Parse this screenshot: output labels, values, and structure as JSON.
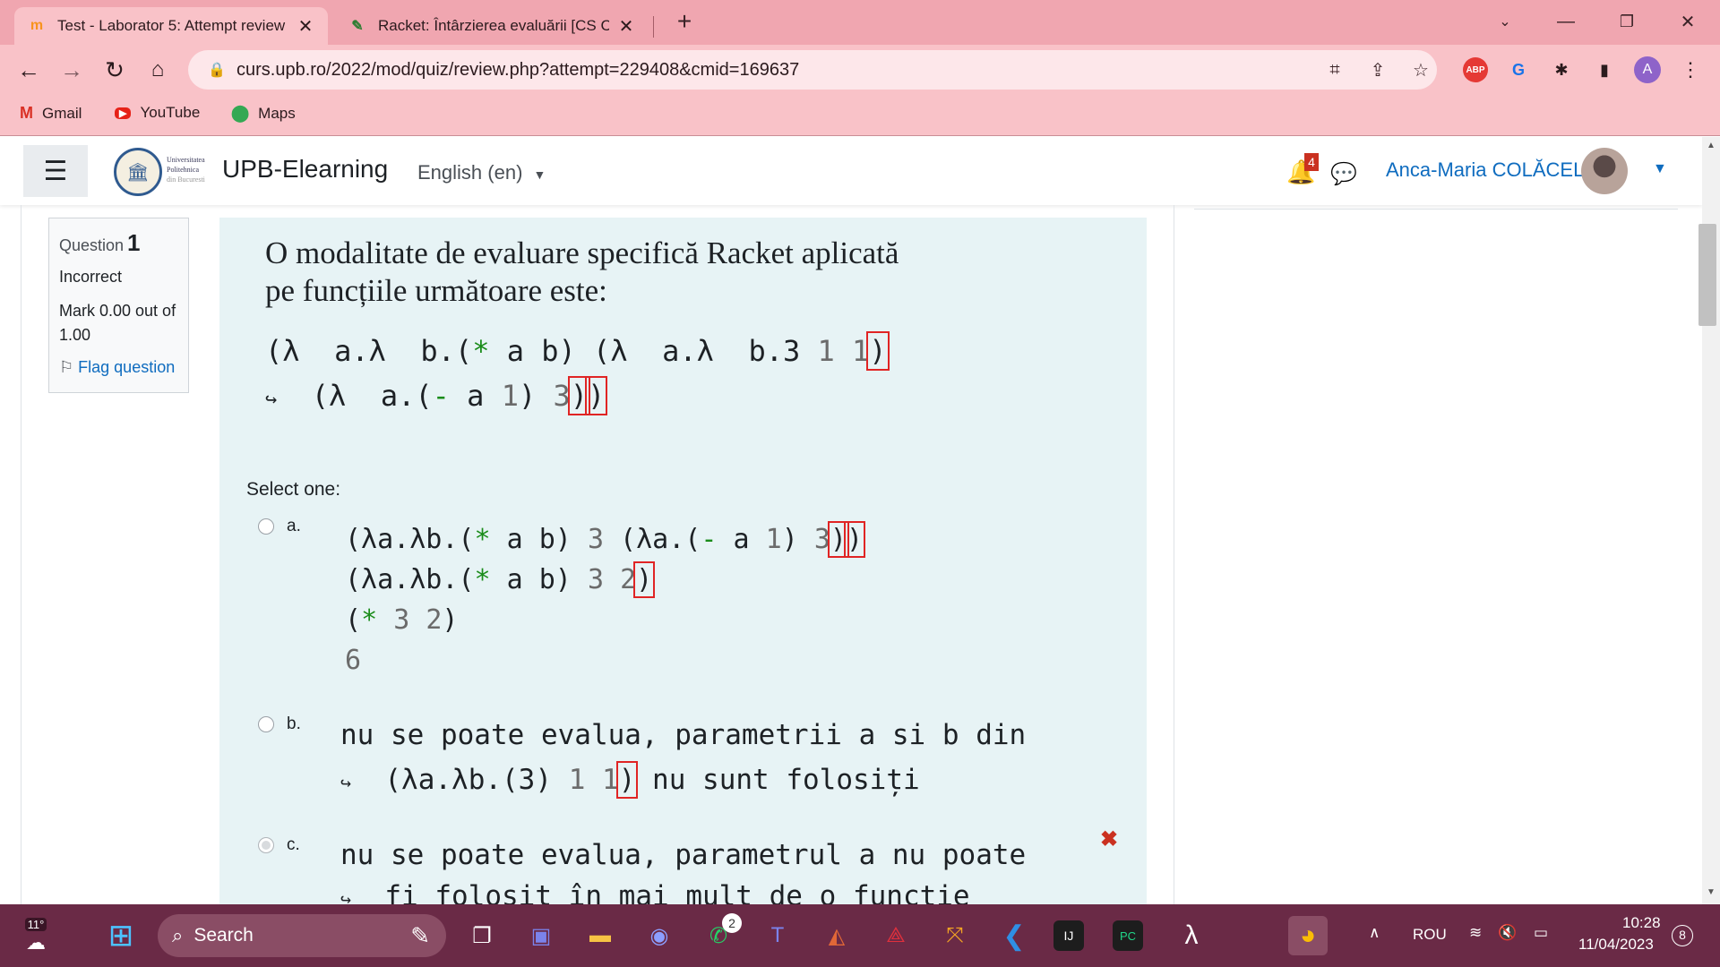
{
  "browser": {
    "tabs": [
      {
        "title": "Test - Laborator 5: Attempt review",
        "favicon": "moodle-icon",
        "active": true
      },
      {
        "title": "Racket: Întârzierea evaluării [CS C",
        "favicon": "book-icon",
        "active": false
      }
    ],
    "address": "curs.upb.ro/2022/mod/quiz/review.php?attempt=229408&cmid=169637",
    "bookmarks": [
      {
        "label": "Gmail",
        "icon": "gmail-icon"
      },
      {
        "label": "YouTube",
        "icon": "youtube-icon"
      },
      {
        "label": "Maps",
        "icon": "maps-icon"
      }
    ],
    "profile_initial": "A",
    "abp_label": "ABP"
  },
  "moodle": {
    "uni_logo_text": [
      "Universitatea",
      "Politehnica",
      "din Bucuresti"
    ],
    "site_name": "UPB-Elearning",
    "language": "English (en)",
    "notification_count": "4",
    "user_name": "Anca-Maria COLĂCEL"
  },
  "question": {
    "label": "Question",
    "number": "1",
    "state": "Incorrect",
    "grade": "Mark 0.00 out of 1.00",
    "flag": "Flag question",
    "text_line1": "O modalitate de evaluare specifică Racket aplicată",
    "text_line2": "pe funcțiile următoare este:",
    "select_one": "Select one:",
    "options": [
      {
        "letter": "a."
      },
      {
        "letter": "b."
      },
      {
        "letter": "c."
      }
    ],
    "optc_line1": "nu se poate evalua, parametrul a nu poate",
    "optc_line2": "fi folosit în mai mult de o funcție"
  },
  "taskbar": {
    "weather": "11°",
    "search_placeholder": "Search",
    "whatsapp_badge": "2",
    "language": "ROU",
    "time": "10:28",
    "date": "11/04/2023",
    "notifications": "8"
  }
}
